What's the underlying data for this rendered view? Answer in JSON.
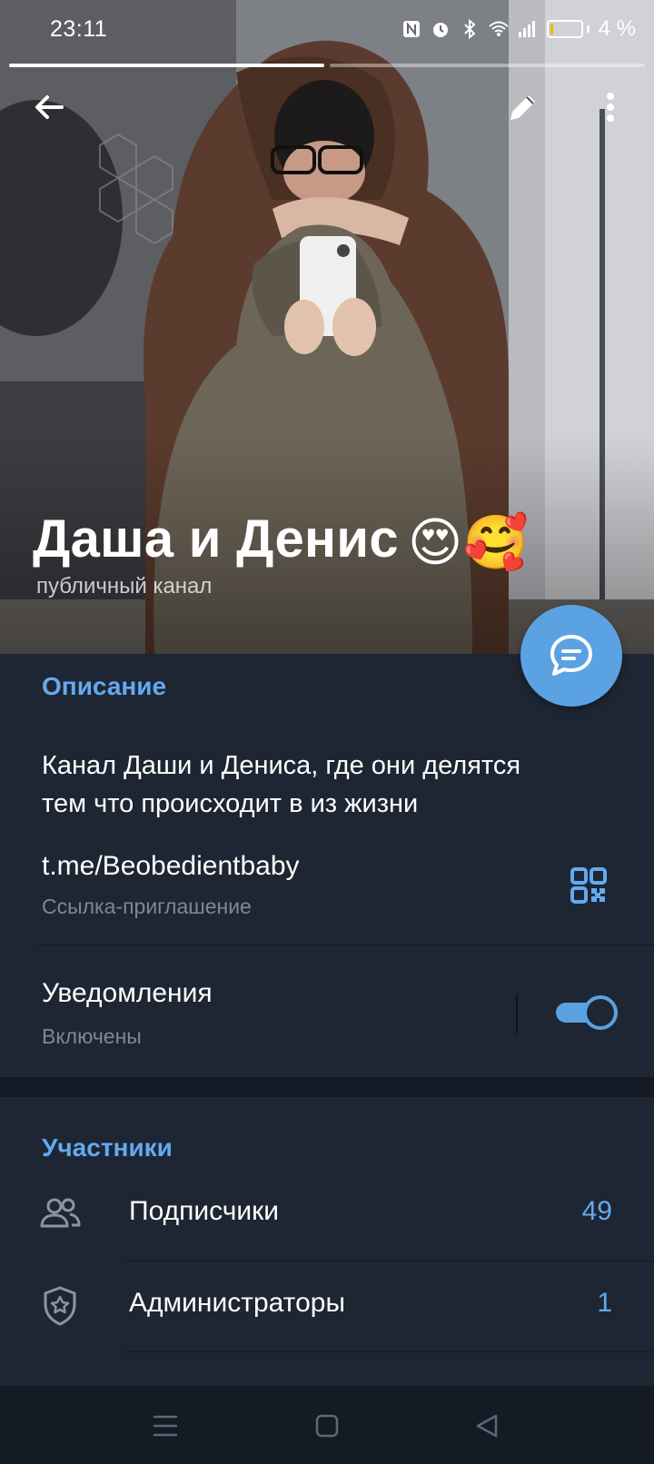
{
  "status_bar": {
    "time": "23:11",
    "battery_level": 0.04,
    "battery_text": "4 %"
  },
  "story_progress": {
    "segments": 2,
    "active_index": 0
  },
  "toolbar": {
    "back_icon": "arrow-left-icon",
    "edit_icon": "pencil-icon",
    "menu_icon": "more-vertical-icon"
  },
  "channel": {
    "title": "Даша и Денис",
    "title_emoji": "😍🥰",
    "subtitle": "публичный канал"
  },
  "fab": {
    "icon": "chat-bubble-icon"
  },
  "info": {
    "description_header": "Описание",
    "description_line1": "Канал Даши и Дениса, где они делятся",
    "description_line2": "тем что происходит в из жизни",
    "link": "t.me/Beobedientbaby",
    "link_caption": "Ссылка-приглашение",
    "qr_icon": "qr-code-icon",
    "notifications_label": "Уведомления",
    "notifications_state": "Включены",
    "notifications_enabled": true
  },
  "members": {
    "header": "Участники",
    "rows": [
      {
        "label": "Подписчики",
        "count": "49",
        "icon": "people-icon"
      },
      {
        "label": "Администраторы",
        "count": "1",
        "icon": "shield-star-icon"
      }
    ]
  },
  "nav": {
    "menu_icon": "nav-menu-icon",
    "home_icon": "nav-home-icon",
    "back_icon": "nav-back-icon"
  },
  "colors": {
    "background": "#1e2633",
    "accent": "#62aaf0",
    "fab": "#5aa2e2",
    "secondary_text": "#7d8896"
  }
}
